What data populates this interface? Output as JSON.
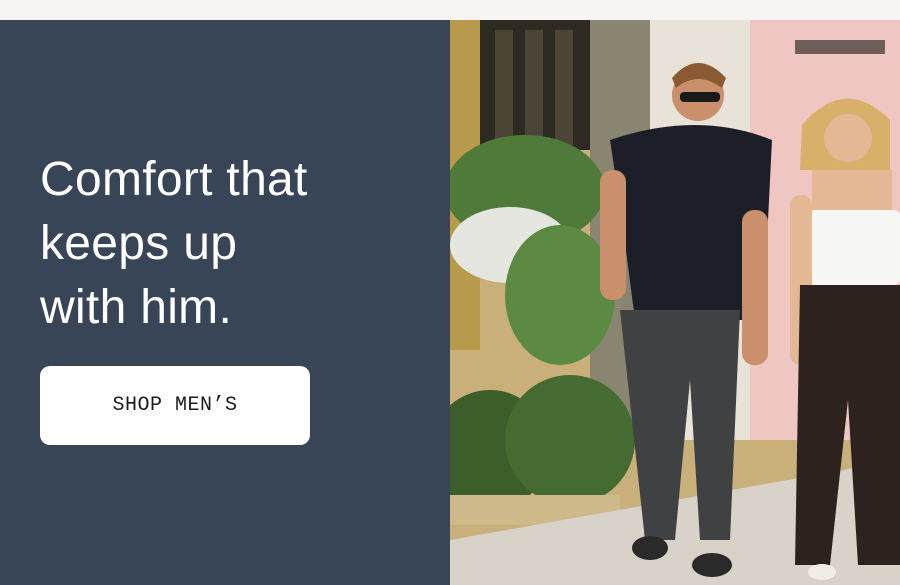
{
  "hero": {
    "headline_lines": [
      "Comfort that",
      "keeps up",
      "with him."
    ],
    "cta_label": "SHOP MEN’S",
    "panel_color": "#374556"
  },
  "photo": {
    "subject": "man in black polo and woman in white top walking on a city sidewalk beside flower planters"
  }
}
